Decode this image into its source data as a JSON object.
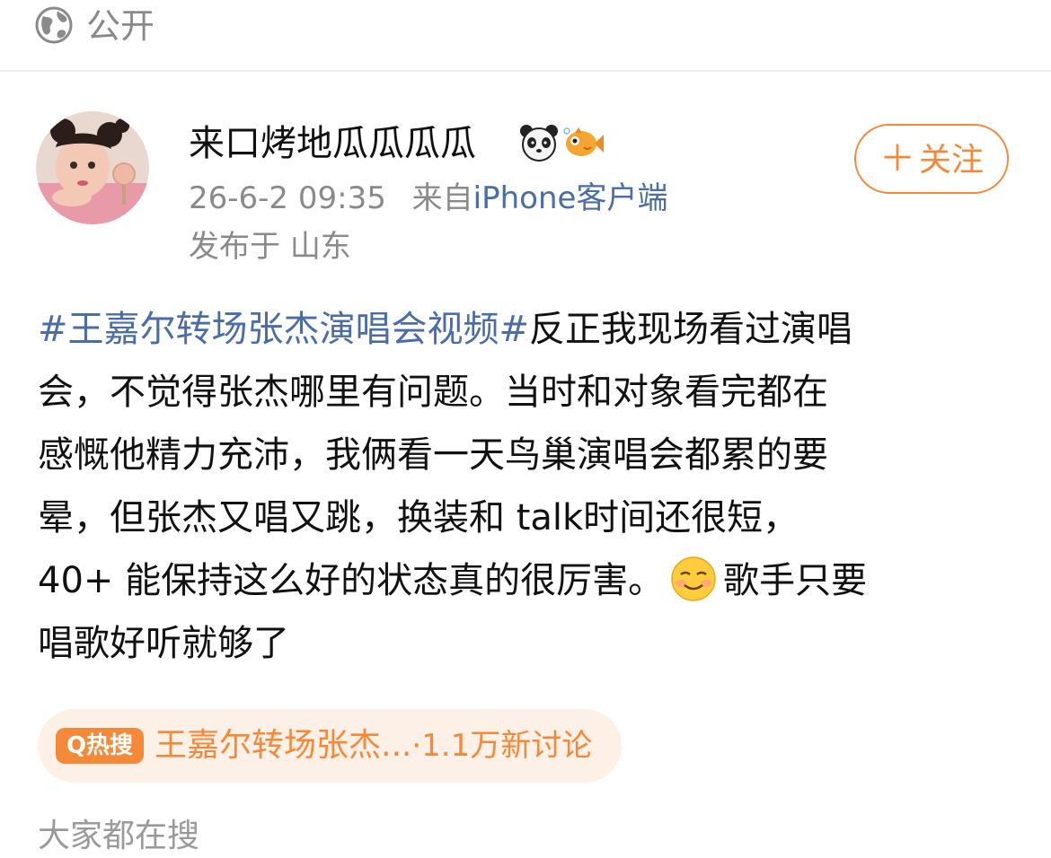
{
  "header": {
    "visibility_icon": "globe-icon",
    "visibility_label": "公开"
  },
  "post": {
    "author": {
      "name": "来口烤地瓜瓜瓜瓜",
      "badges": [
        "panda-badge-icon",
        "fish-badge-icon"
      ],
      "avatar_icon": "user-avatar"
    },
    "follow_label": "关注",
    "time": "26-6-2 09:35",
    "source_prefix": "来自",
    "source": "iPhone客户端",
    "location_prefix": "发布于",
    "location": "山东",
    "content": {
      "hashtag": "#王嘉尔转场张杰演唱会视频#",
      "line1_rest": "反正我现场看过演唱",
      "line2": "会，不觉得张杰哪里有问题。当时和对象看完都在",
      "line3": "感慨他精力充沛，我俩看一天鸟巢演唱会都累的要",
      "line4": "晕，但张杰又唱又跳，换装和 talk时间还很短，",
      "line5_before_emoji": "40+ 能保持这么好的状态真的很厉害。",
      "emoji": "smiling-face-icon",
      "line5_after_emoji": "歌手只要",
      "line6": "唱歌好听就够了"
    },
    "hot_search": {
      "badge_icon": "search-icon",
      "badge_label": "热搜",
      "topic": "王嘉尔转场张杰...",
      "count": "·1.1万新讨论"
    },
    "cutoff_text": "大家都在搜"
  },
  "colors": {
    "accent_orange": "#f5893a",
    "link_blue": "#4a6da7",
    "meta_gray": "#8a8a8a",
    "hot_bg": "#fdf0e6"
  }
}
